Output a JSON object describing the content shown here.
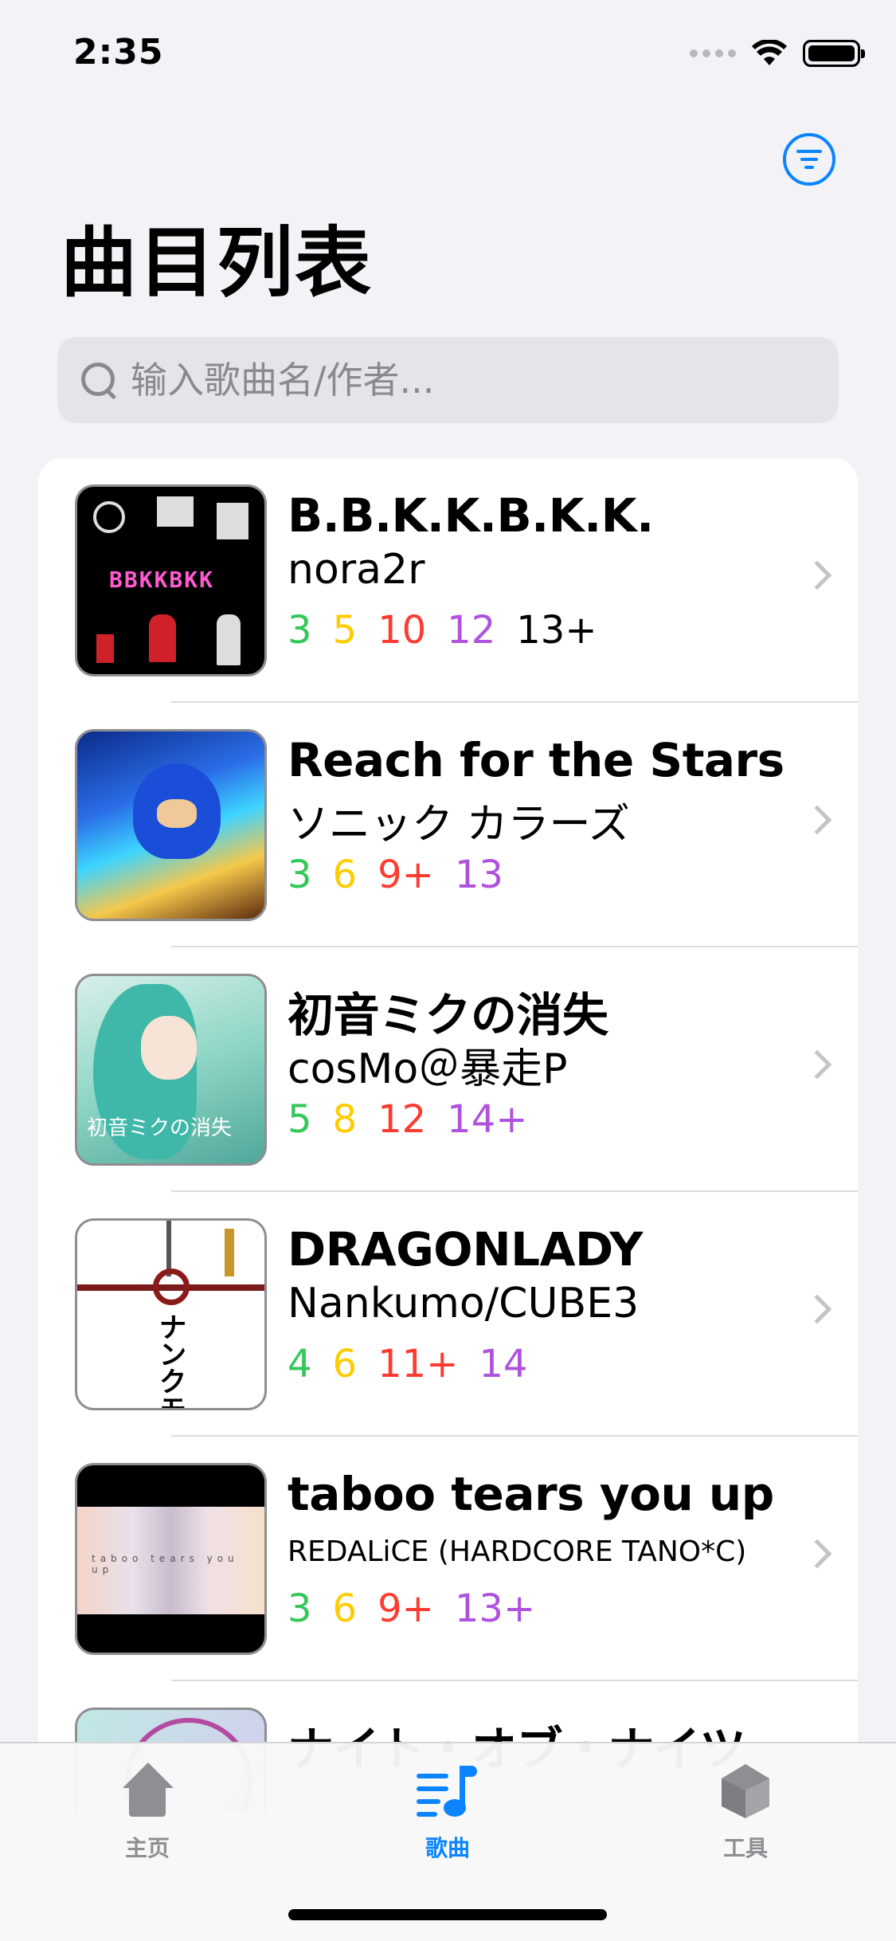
{
  "status_bar": {
    "time": "2:35"
  },
  "header": {
    "title": "曲目列表"
  },
  "search": {
    "placeholder": "输入歌曲名/作者..."
  },
  "songs": [
    {
      "title": "B.B.K.K.B.K.K.",
      "artist": "nora2r",
      "levels": [
        "3",
        "5",
        "10",
        "12",
        "13+"
      ]
    },
    {
      "title": "Reach for the Stars",
      "artist": "ソニック カラーズ",
      "levels": [
        "3",
        "6",
        "9+",
        "13"
      ]
    },
    {
      "title": "初音ミクの消失",
      "artist": "cosMo＠暴走P",
      "levels": [
        "5",
        "8",
        "12",
        "14+"
      ]
    },
    {
      "title": "DRAGONLADY",
      "artist": "Nankumo/CUBE3",
      "levels": [
        "4",
        "6",
        "11+",
        "14"
      ]
    },
    {
      "title": "taboo tears you up",
      "artist": "REDALiCE (HARDCORE TANO*C)",
      "levels": [
        "3",
        "6",
        "9+",
        "13+"
      ]
    },
    {
      "title": "ナイト・オブ・ナイツ"
    }
  ],
  "covers": {
    "bbkkbkk_text": "BBKKBKK",
    "shoushitsu_text": "初音ミクの消失",
    "dragonlady_text": "ナンクモ",
    "taboo_text": "taboo tears you up"
  },
  "tab_bar": {
    "tabs": [
      {
        "label": "主页",
        "icon": "home-icon"
      },
      {
        "label": "歌曲",
        "icon": "music-list-icon"
      },
      {
        "label": "工具",
        "icon": "box-icon"
      }
    ],
    "active": "歌曲"
  },
  "colors": {
    "accent": "#0a84ff",
    "basic": "#34c759",
    "advanced": "#ffcc00",
    "expert": "#ff3b30",
    "master": "#af52de",
    "remaster": "#000000"
  }
}
